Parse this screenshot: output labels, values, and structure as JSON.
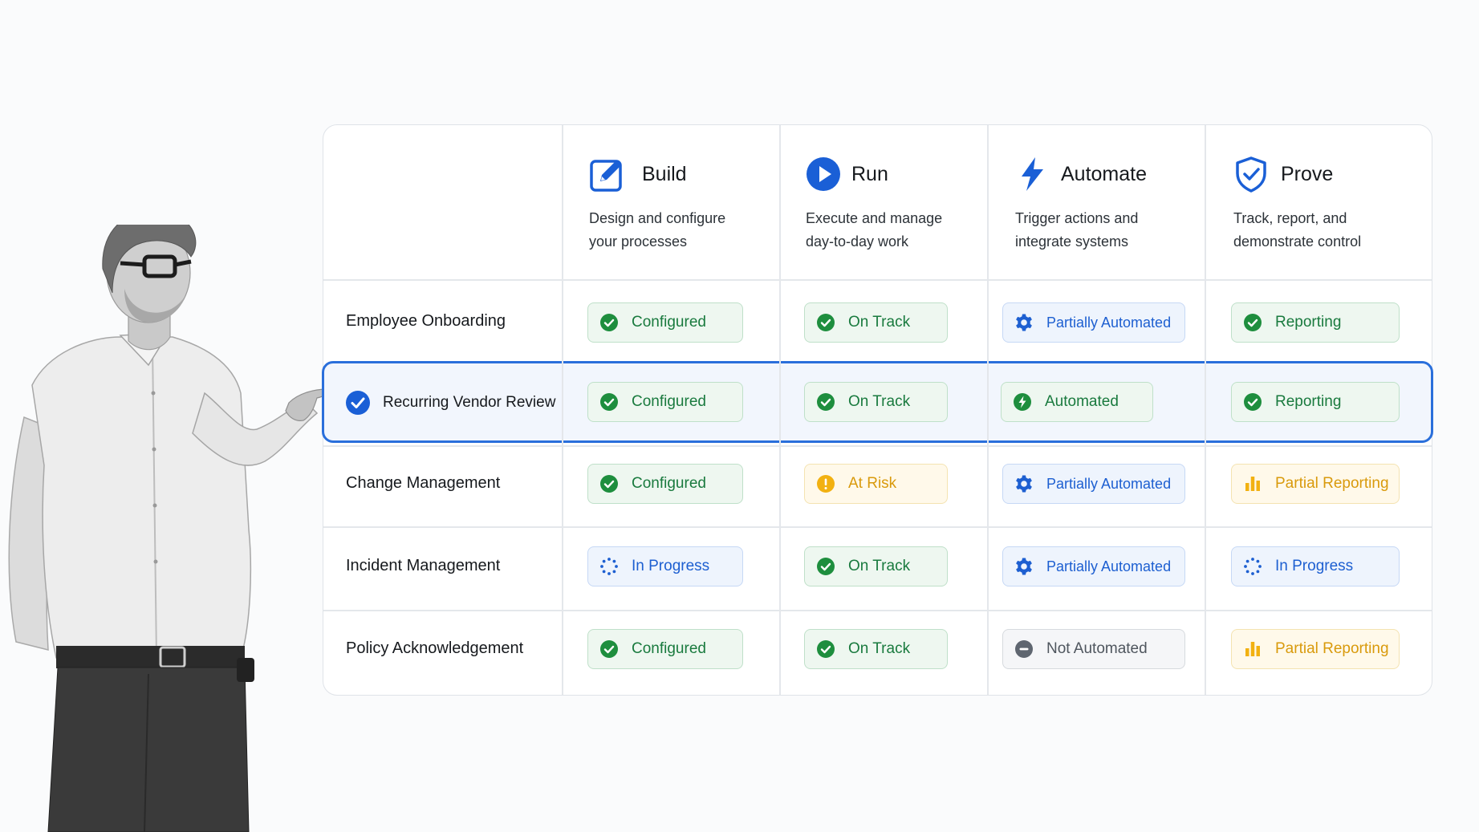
{
  "colors": {
    "accent": "#1a5fd6",
    "success": "#1e8e3e",
    "warning": "#f2b111",
    "neutral": "#5f6670"
  },
  "columns": [
    {
      "title": "Build",
      "description_line1": "Design and configure",
      "description_line2": "your processes",
      "icon": "edit-square-icon"
    },
    {
      "title": "Run",
      "description_line1": "Execute and manage",
      "description_line2": "day-to-day work",
      "icon": "play-circle-icon"
    },
    {
      "title": "Automate",
      "description_line1": "Trigger actions and",
      "description_line2": "integrate systems",
      "icon": "lightning-bolt-icon"
    },
    {
      "title": "Prove",
      "description_line1": "Track, report, and",
      "description_line2": "demonstrate control",
      "icon": "shield-check-icon"
    }
  ],
  "rows": [
    {
      "label": "Employee Onboarding",
      "selected": false,
      "cells": [
        {
          "text": "Configured",
          "variant": "success",
          "icon": "check-circle-icon"
        },
        {
          "text": "On Track",
          "variant": "success",
          "icon": "check-circle-icon"
        },
        {
          "text": "Partially Automated",
          "variant": "info",
          "icon": "gear-icon"
        },
        {
          "text": "Reporting",
          "variant": "success",
          "icon": "check-circle-icon"
        }
      ]
    },
    {
      "label": "Recurring Vendor Review",
      "selected": true,
      "cells": [
        {
          "text": "Configured",
          "variant": "success",
          "icon": "check-circle-icon"
        },
        {
          "text": "On Track",
          "variant": "success",
          "icon": "check-circle-icon"
        },
        {
          "text": "Automated",
          "variant": "success",
          "icon": "bolt-circle-icon"
        },
        {
          "text": "Reporting",
          "variant": "success",
          "icon": "check-circle-icon"
        }
      ]
    },
    {
      "label": "Change Management",
      "selected": false,
      "cells": [
        {
          "text": "Configured",
          "variant": "success",
          "icon": "check-circle-icon"
        },
        {
          "text": "At Risk",
          "variant": "warning",
          "icon": "alert-circle-icon"
        },
        {
          "text": "Partially Automated",
          "variant": "info",
          "icon": "gear-icon"
        },
        {
          "text": "Partial Reporting",
          "variant": "warning",
          "icon": "bar-chart-icon"
        }
      ]
    },
    {
      "label": "Incident Management",
      "selected": false,
      "cells": [
        {
          "text": "In Progress",
          "variant": "info",
          "icon": "spinner-icon"
        },
        {
          "text": "On Track",
          "variant": "success",
          "icon": "check-circle-icon"
        },
        {
          "text": "Partially Automated",
          "variant": "info",
          "icon": "gear-icon"
        },
        {
          "text": "In Progress",
          "variant": "info",
          "icon": "spinner-icon"
        }
      ]
    },
    {
      "label": "Policy Acknowledgement",
      "selected": false,
      "cells": [
        {
          "text": "Configured",
          "variant": "success",
          "icon": "check-circle-icon"
        },
        {
          "text": "On Track",
          "variant": "success",
          "icon": "check-circle-icon"
        },
        {
          "text": "Not Automated",
          "variant": "neutral",
          "icon": "minus-circle-icon"
        },
        {
          "text": "Partial Reporting",
          "variant": "warning",
          "icon": "bar-chart-icon"
        }
      ]
    }
  ]
}
